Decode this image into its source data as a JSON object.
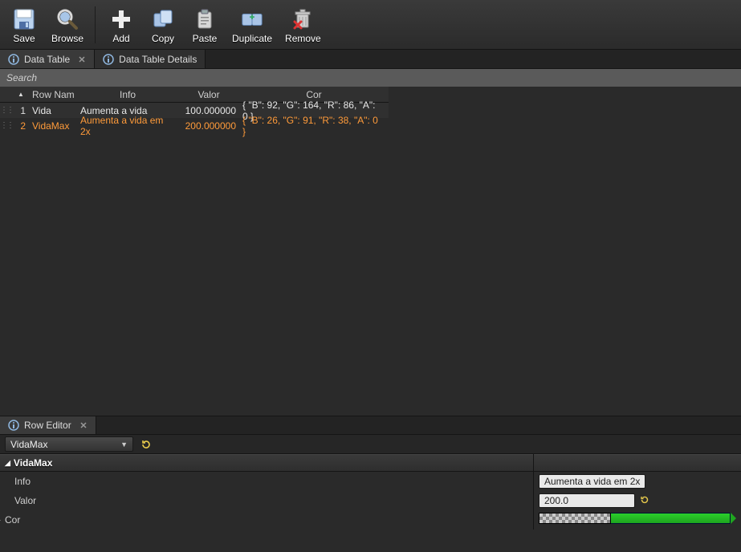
{
  "toolbar": {
    "save": "Save",
    "browse": "Browse",
    "add": "Add",
    "copy": "Copy",
    "paste": "Paste",
    "duplicate": "Duplicate",
    "remove": "Remove"
  },
  "tabs": {
    "data_table": "Data Table",
    "data_table_details": "Data Table Details"
  },
  "search": {
    "placeholder": "Search"
  },
  "table": {
    "headers": {
      "row_name": "Row Nam",
      "info": "Info",
      "valor": "Valor",
      "cor": "Cor"
    },
    "rows": [
      {
        "idx": "1",
        "name": "Vida",
        "info": "Aumenta a vida",
        "valor": "100.000000",
        "cor": "{ \"B\": 92, \"G\": 164, \"R\": 86, \"A\": 0 }"
      },
      {
        "idx": "2",
        "name": "VidaMax",
        "info": "Aumenta a vida em 2x",
        "valor": "200.000000",
        "cor": "{ \"B\": 26, \"G\": 91, \"R\": 38, \"A\": 0 }"
      }
    ]
  },
  "row_editor": {
    "tab": "Row Editor",
    "selected": "VidaMax"
  },
  "detail": {
    "header": "VidaMax",
    "info_label": "Info",
    "valor_label": "Valor",
    "cor_label": "Cor",
    "info_value": "Aumenta a vida em 2x",
    "valor_value": "200.0"
  },
  "colors": {
    "accent": "#ff9b3a"
  }
}
